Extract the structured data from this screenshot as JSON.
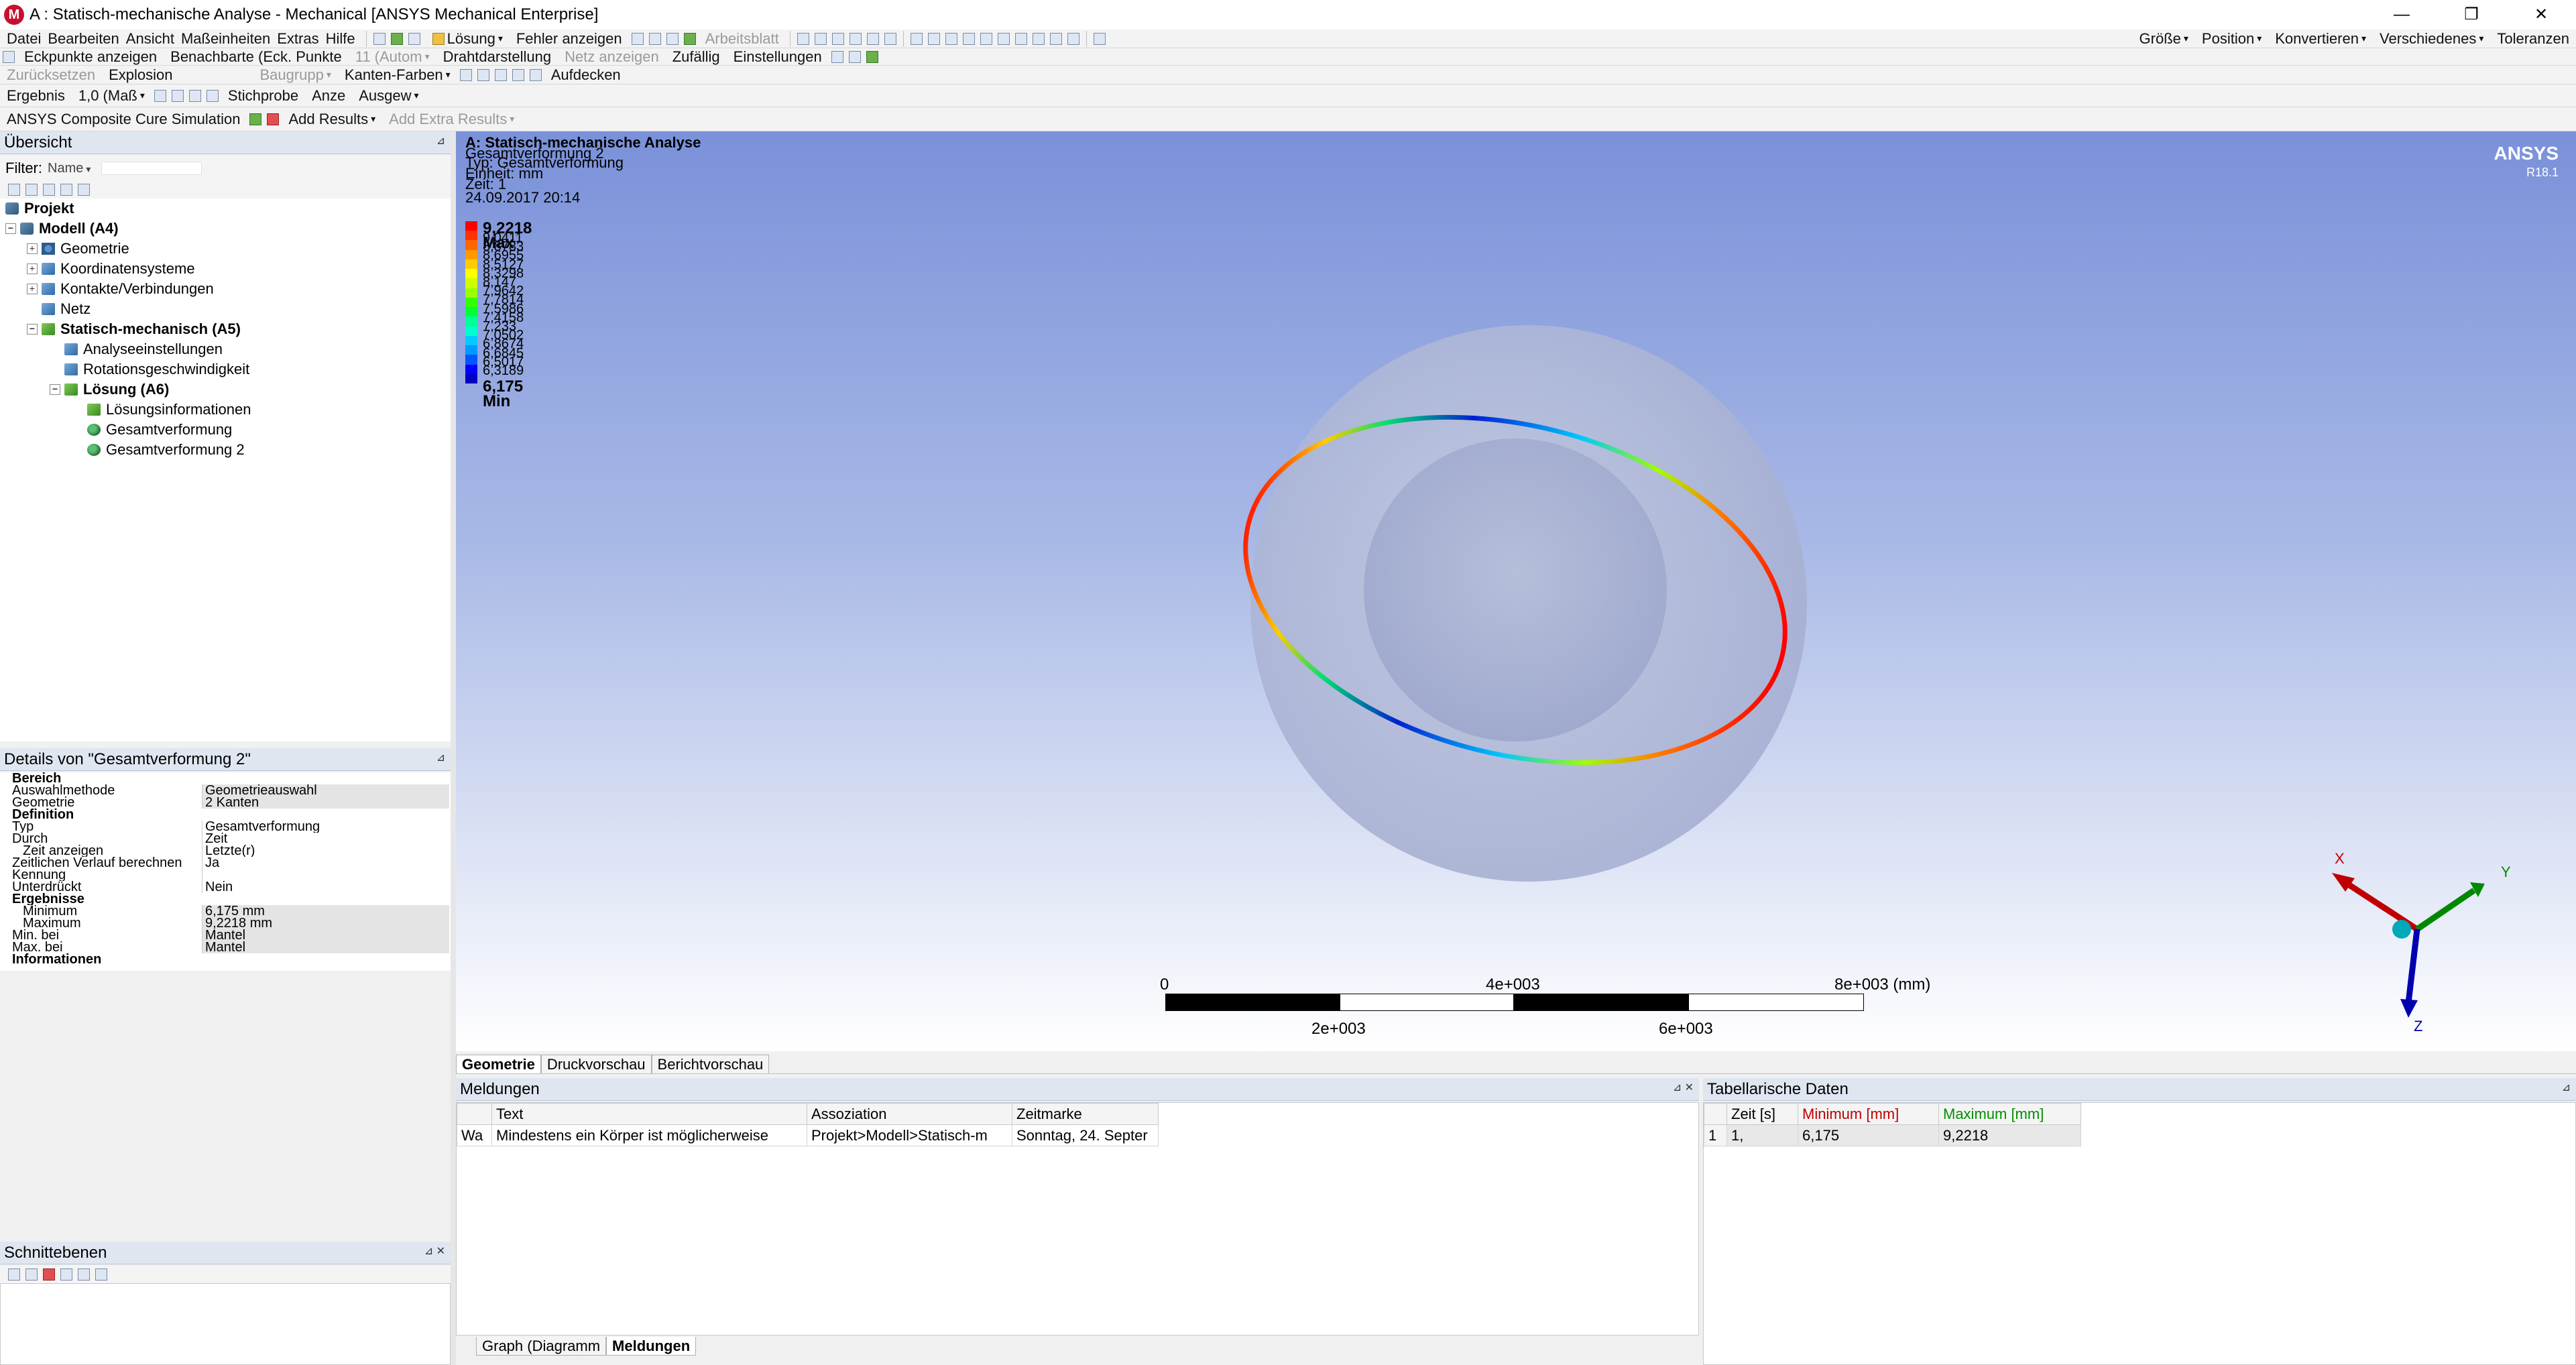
{
  "window": {
    "title": "A : Statisch-mechanische Analyse - Mechanical [ANSYS Mechanical Enterprise]",
    "app_icon": "M",
    "minimize": "—",
    "maximize": "❐",
    "close": "✕"
  },
  "menubar": [
    "Datei",
    "Bearbeiten",
    "Ansicht",
    "Maßeinheiten",
    "Extras",
    "Hilfe"
  ],
  "toolbar1": {
    "solve": "Lösung",
    "show_errors": "Fehler anzeigen",
    "worksheet": "Arbeitsblatt",
    "size": "Größe",
    "position": "Position",
    "convert": "Konvertieren",
    "misc": "Verschiedenes",
    "tolerances": "Toleranzen"
  },
  "toolbar2": {
    "show_vertices": "Eckpunkte anzeigen",
    "adjacent": "Benachbarte (Eck. Punkte",
    "auto": "11 (Autom",
    "wireframe": "Drahtdarstellung",
    "show_mesh": "Netz anzeigen",
    "random": "Zufällig",
    "settings": "Einstellungen"
  },
  "toolbar3": {
    "reset": "Zurücksetzen",
    "explode": "Explosion",
    "assembly": "Baugrupp",
    "edge_coloring": "Kanten-Farben",
    "labels": "Aufdecken"
  },
  "toolbar4": {
    "result_label": "Ergebnis",
    "scale": "1,0 (Maß",
    "probe": "Stichprobe",
    "display": "Anze",
    "display2": "Ausgew"
  },
  "toolbar5": {
    "cure_sim": "ANSYS Composite Cure Simulation",
    "add_results": "Add Results",
    "add_extra_results": "Add Extra Results"
  },
  "outline": {
    "header": "Übersicht",
    "filter_label": "Filter:",
    "filter_value": "Name",
    "project": "Projekt",
    "model": "Modell (A4)",
    "geometry": "Geometrie",
    "coord_systems": "Koordinatensysteme",
    "contacts": "Kontakte/Verbindungen",
    "mesh": "Netz",
    "static": "Statisch-mechanisch (A5)",
    "analysis_settings": "Analyseeinstellungen",
    "rotation": "Rotationsgeschwindigkeit",
    "solution": "Lösung (A6)",
    "solution_info": "Lösungsinformationen",
    "total_def": "Gesamtverformung",
    "total_def2": "Gesamtverformung 2"
  },
  "details": {
    "header": "Details von \"Gesamtverformung 2\"",
    "cat_scope": "Bereich",
    "scoping_method_k": "Auswahlmethode",
    "scoping_method_v": "Geometrieauswahl",
    "geometry_k": "Geometrie",
    "geometry_v": "2 Kanten",
    "cat_definition": "Definition",
    "type_k": "Typ",
    "type_v": "Gesamtverformung",
    "by_k": "Durch",
    "by_v": "Zeit",
    "display_time_k": "Zeit anzeigen",
    "display_time_v": "Letzte(r)",
    "history_k": "Zeitlichen Verlauf berechnen",
    "history_v": "Ja",
    "identifier_k": "Kennung",
    "identifier_v": "",
    "suppressed_k": "Unterdrückt",
    "suppressed_v": "Nein",
    "cat_results": "Ergebnisse",
    "min_k": "Minimum",
    "min_v": "6,175 mm",
    "max_k": "Maximum",
    "max_v": "9,2218 mm",
    "min_at_k": "Min. bei",
    "min_at_v": "Mantel",
    "max_at_k": "Max. bei",
    "max_at_v": "Mantel",
    "cat_info": "Informationen"
  },
  "section_planes": {
    "header": "Schnittebenen"
  },
  "viewport": {
    "analysis_title": "A: Statisch-mechanische Analyse",
    "type_line": "Typ: Gesamtverformung",
    "result_name": "Gesamtverformung 2",
    "unit_line": "Einheit: mm",
    "time_line": "Zeit: 1",
    "date_line": "24.09.2017 20:14",
    "legend_max": "9,2218 Max",
    "legend_min": "6,175 Min",
    "legend_values": [
      "9,0411",
      "8,8783",
      "8,6955",
      "8,5127",
      "8,3298",
      "8,147",
      "7,9642",
      "7,7814",
      "7,5986",
      "7,4158",
      "7,233",
      "7,0502",
      "6,8674",
      "6,6845",
      "6,5017",
      "6,3189"
    ],
    "legend_colors": [
      "#ff0000",
      "#ff3300",
      "#ff6600",
      "#ff9900",
      "#ffcc00",
      "#ffff00",
      "#ccff00",
      "#99ff00",
      "#33ff00",
      "#00ff33",
      "#00ff99",
      "#00ffcc",
      "#00ccff",
      "#0099ff",
      "#0055ff",
      "#0000ff"
    ],
    "brand": "ANSYS",
    "version": "R18.1",
    "scale_0": "0",
    "scale_4": "4e+003",
    "scale_8": "8e+003 (mm)",
    "scale_2": "2e+003",
    "scale_6": "6e+003",
    "axis_x": "X",
    "axis_y": "Y",
    "axis_z": "Z"
  },
  "view_tabs": [
    "Geometrie",
    "Druckvorschau",
    "Berichtvorschau"
  ],
  "messages": {
    "header": "Meldungen",
    "columns": [
      "Text",
      "Assoziation",
      "Zeitmarke"
    ],
    "row": {
      "type": "Wa",
      "text": "Mindestens ein Körper ist möglicherweise",
      "assoc": "Projekt>Modell>Statisch-m",
      "time": "Sonntag, 24. Septer"
    }
  },
  "bottom_tabs": [
    "Graph (Diagramm",
    "Meldungen"
  ],
  "tabular": {
    "header": "Tabellarische Daten",
    "columns": [
      "Zeit [s]",
      "Minimum [mm]",
      "Maximum [mm]"
    ],
    "row_index": "1",
    "row": [
      "1,",
      "6,175",
      "9,2218"
    ],
    "min_color": "#c00000",
    "max_color": "#009000"
  }
}
